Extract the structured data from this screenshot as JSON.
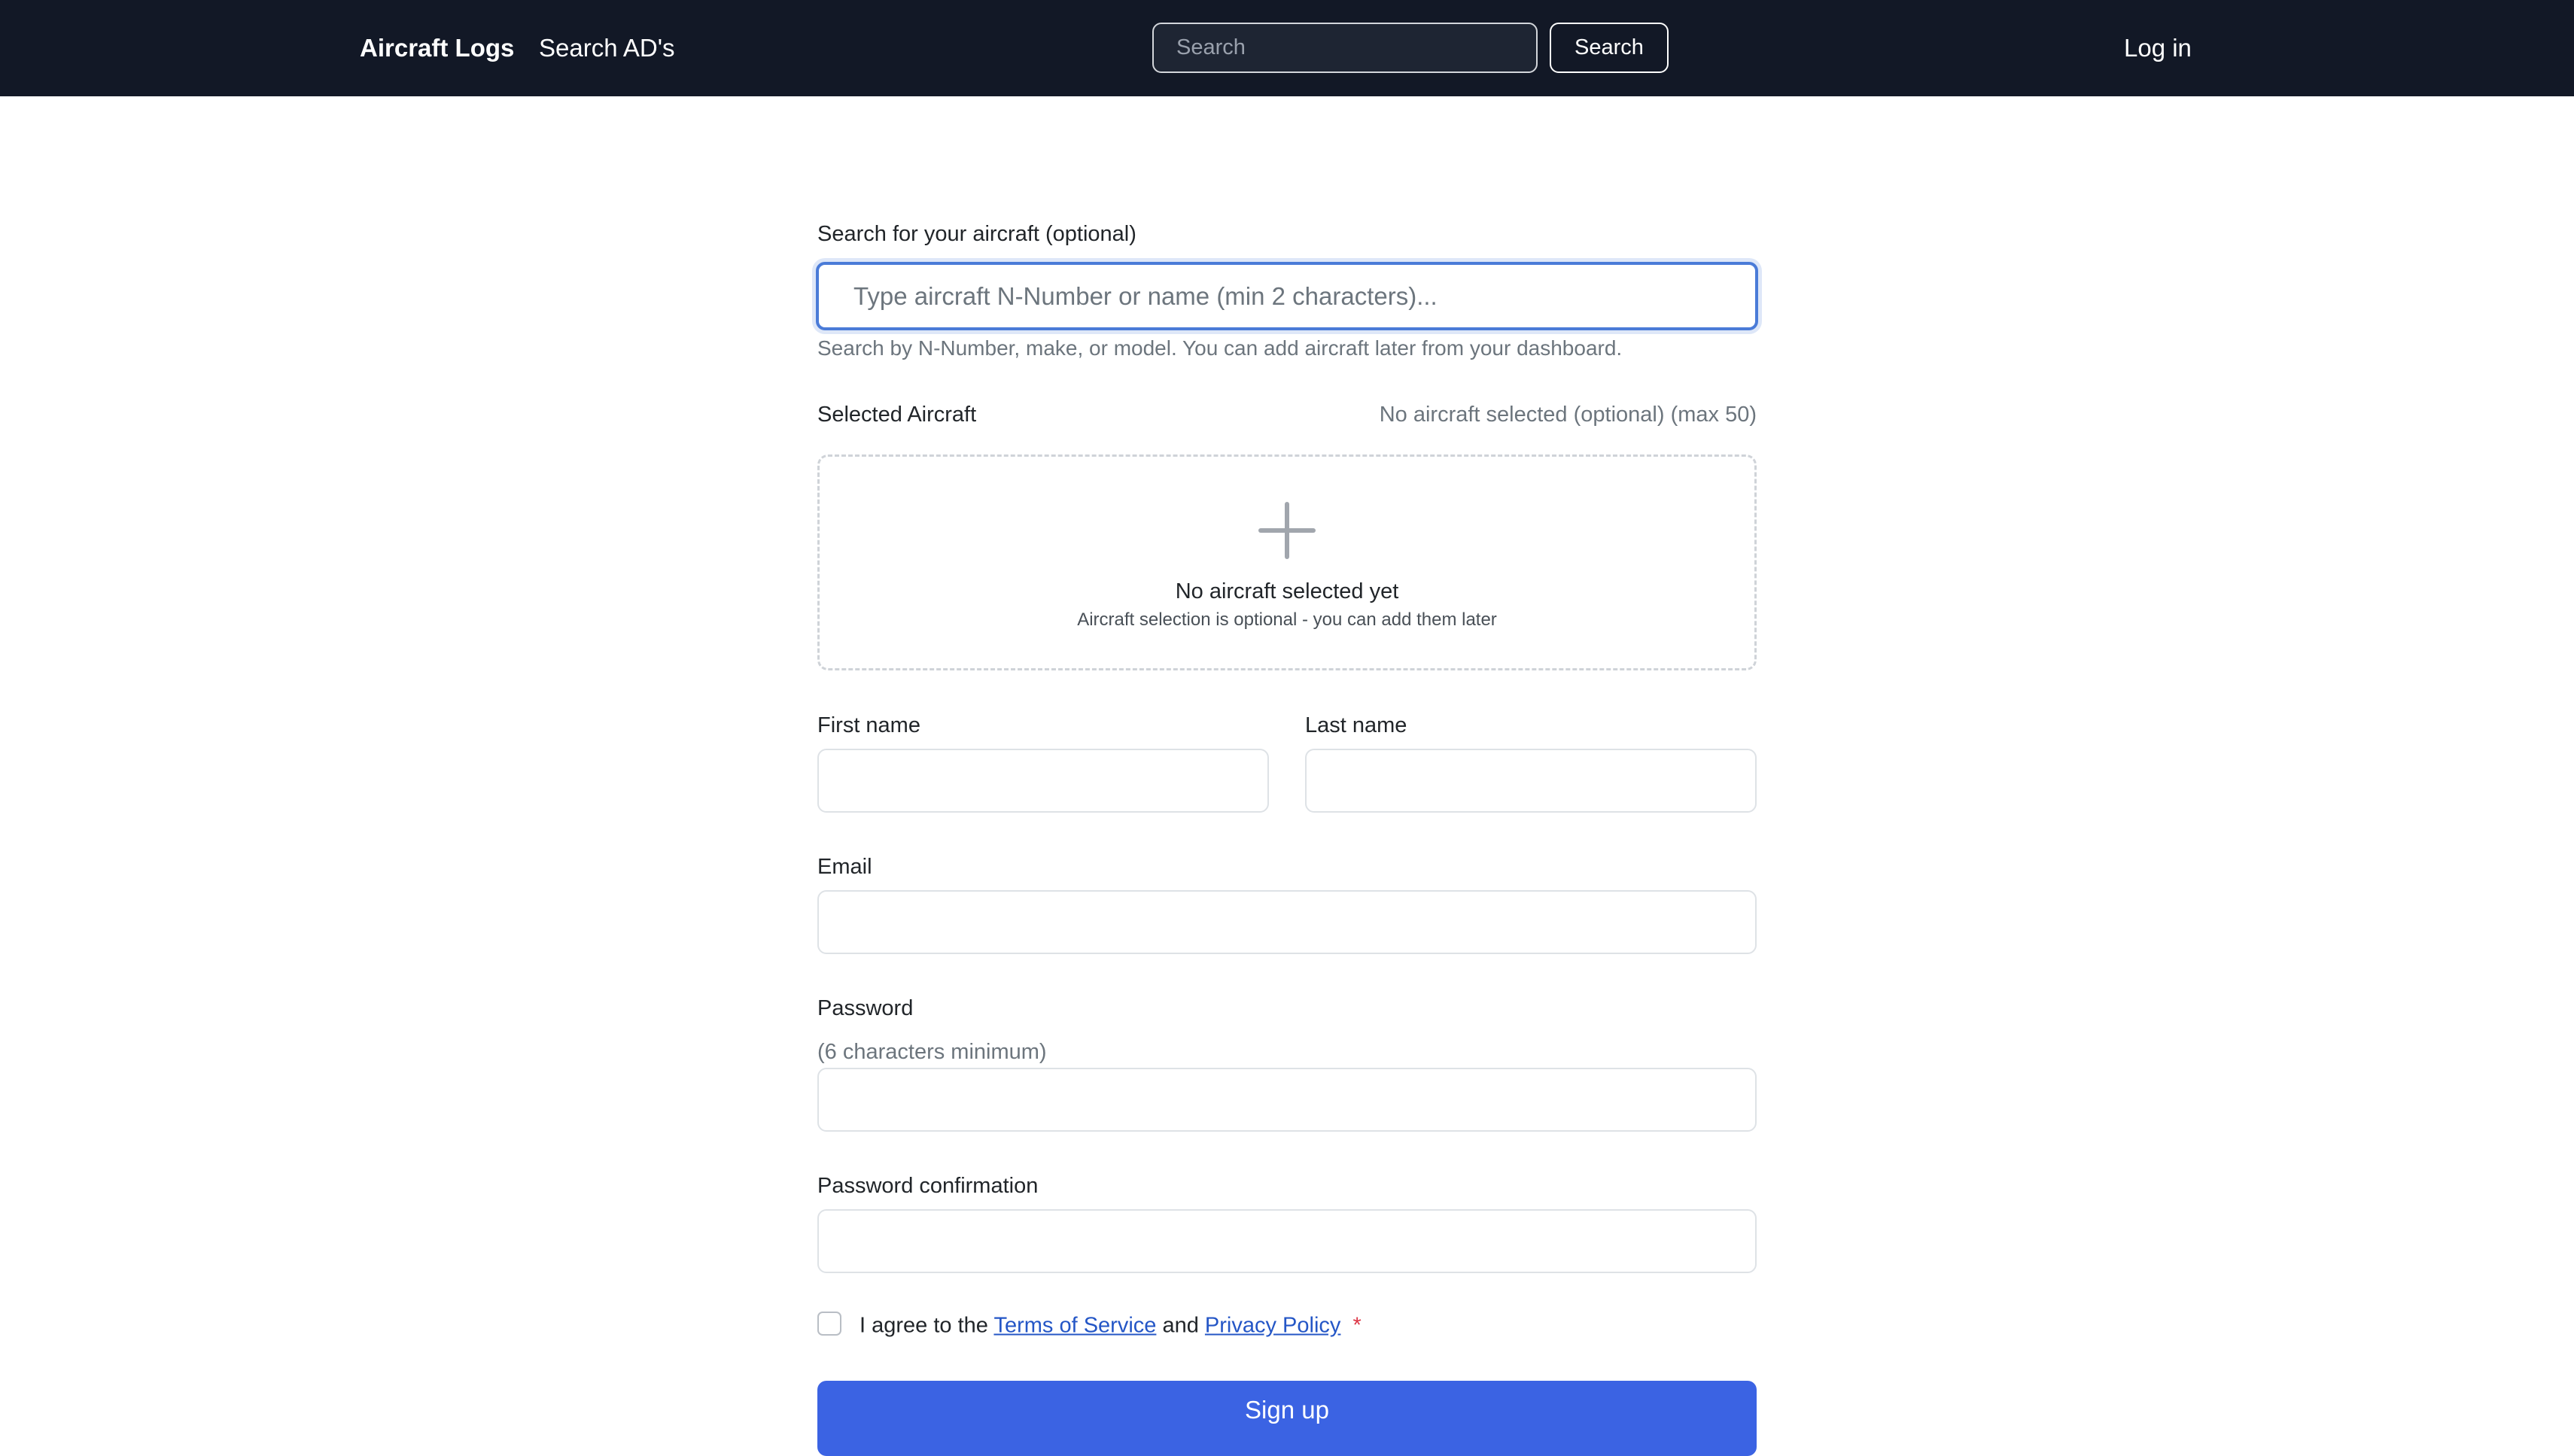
{
  "navbar": {
    "brand": "Aircraft Logs",
    "search_ads_link": "Search AD's",
    "search_placeholder": "Search",
    "search_button": "Search",
    "login_link": "Log in"
  },
  "form": {
    "aircraft_search": {
      "label": "Search for your aircraft (optional)",
      "placeholder": "Type aircraft N-Number or name (min 2 characters)...",
      "help": "Search by N-Number, make, or model. You can add aircraft later from your dashboard."
    },
    "selected_aircraft": {
      "label": "Selected Aircraft",
      "status": "No aircraft selected (optional) (max 50)",
      "empty_title": "No aircraft selected yet",
      "empty_subtitle": "Aircraft selection is optional - you can add them later"
    },
    "first_name_label": "First name",
    "last_name_label": "Last name",
    "email_label": "Email",
    "password_label": "Password",
    "password_hint": "(6 characters minimum)",
    "password_confirmation_label": "Password confirmation",
    "agree": {
      "prefix": "I agree to the",
      "terms": "Terms of Service",
      "and": "and",
      "privacy": "Privacy Policy",
      "required_mark": "*"
    },
    "submit": "Sign up"
  },
  "colors": {
    "navbar_bg": "#121826",
    "primary_button": "#3b63e3",
    "link": "#2456c6",
    "required": "#dc3545"
  }
}
